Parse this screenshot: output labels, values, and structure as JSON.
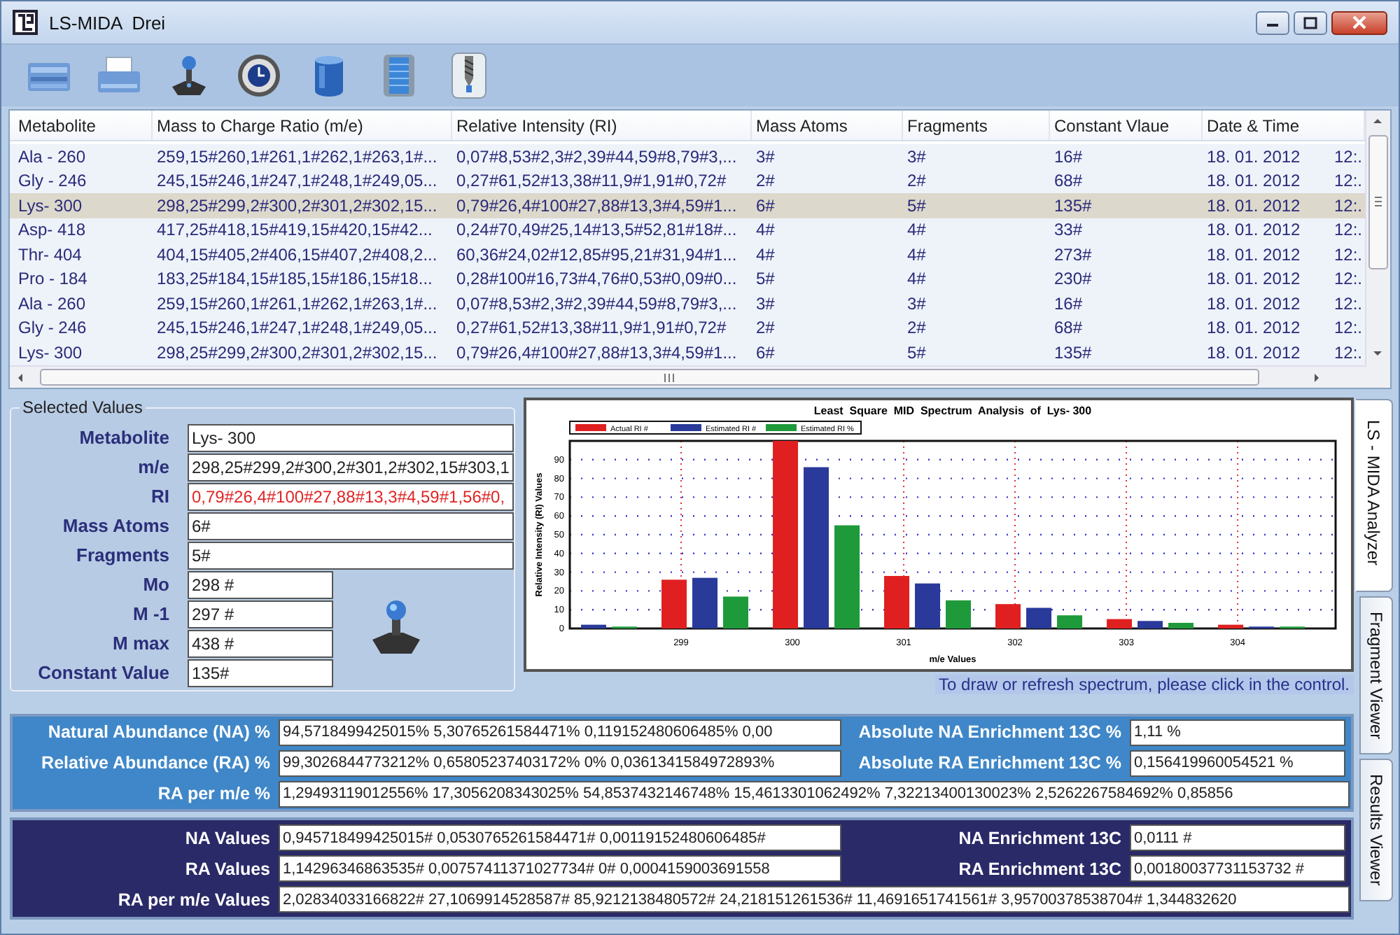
{
  "window": {
    "title": "LS-MIDA  Drei"
  },
  "table": {
    "columns": [
      "Metabolite",
      "Mass to Charge Ratio (m/e)",
      "Relative Intensity (RI)",
      "Mass Atoms",
      "Fragments",
      "Constant Vlaue",
      "Date & Time"
    ],
    "rows": [
      {
        "selected": false,
        "cells": [
          "Ala - 260",
          "259,15#260,1#261,1#262,1#263,1#...",
          "0,07#8,53#2,3#2,39#44,59#8,79#3,...",
          "3#",
          "3#",
          "16#",
          "18. 01. 2012",
          "12:."
        ]
      },
      {
        "selected": false,
        "cells": [
          "Gly - 246",
          "245,15#246,1#247,1#248,1#249,05...",
          "0,27#61,52#13,38#11,9#1,91#0,72#",
          "2#",
          "2#",
          "68#",
          "18. 01. 2012",
          "12:."
        ]
      },
      {
        "selected": true,
        "cells": [
          "Lys- 300",
          "298,25#299,2#300,2#301,2#302,15...",
          "0,79#26,4#100#27,88#13,3#4,59#1...",
          "6#",
          "5#",
          "135#",
          "18. 01. 2012",
          "12:."
        ]
      },
      {
        "selected": false,
        "cells": [
          "Asp- 418",
          "417,25#418,15#419,15#420,15#42...",
          "0,24#70,49#25,14#13,5#52,81#18#...",
          "4#",
          "4#",
          "33#",
          "18. 01. 2012",
          "12:."
        ]
      },
      {
        "selected": false,
        "cells": [
          "Thr- 404",
          "404,15#405,2#406,15#407,2#408,2...",
          "60,36#24,02#12,85#95,21#31,94#1...",
          "4#",
          "4#",
          "273#",
          "18. 01. 2012",
          "12:."
        ]
      },
      {
        "selected": false,
        "cells": [
          "Pro - 184",
          "183,25#184,15#185,15#186,15#18...",
          "0,28#100#16,73#4,76#0,53#0,09#0...",
          "5#",
          "4#",
          "230#",
          "18. 01. 2012",
          "12:."
        ]
      },
      {
        "selected": false,
        "cells": [
          "Ala - 260",
          "259,15#260,1#261,1#262,1#263,1#...",
          "0,07#8,53#2,3#2,39#44,59#8,79#3,...",
          "3#",
          "3#",
          "16#",
          "18. 01. 2012",
          "12:."
        ]
      },
      {
        "selected": false,
        "cells": [
          "Gly - 246",
          "245,15#246,1#247,1#248,1#249,05...",
          "0,27#61,52#13,38#11,9#1,91#0,72#",
          "2#",
          "2#",
          "68#",
          "18. 01. 2012",
          "12:."
        ]
      },
      {
        "selected": false,
        "cells": [
          "Lys- 300",
          "298,25#299,2#300,2#301,2#302,15...",
          "0,79#26,4#100#27,88#13,3#4,59#1...",
          "6#",
          "5#",
          "135#",
          "18. 01. 2012",
          "12:."
        ]
      }
    ]
  },
  "selected_values": {
    "title": "Selected Values",
    "fields": [
      {
        "kind": "wide",
        "label": "Metabolite",
        "value": "Lys- 300",
        "highlight": false
      },
      {
        "kind": "wide",
        "label": "m/e",
        "value": "298,25#299,2#300,2#301,2#302,15#303,1",
        "highlight": false
      },
      {
        "kind": "wide",
        "label": "RI",
        "value": "0,79#26,4#100#27,88#13,3#4,59#1,56#0,",
        "highlight": true
      },
      {
        "kind": "wide",
        "label": "Mass Atoms",
        "value": "6#",
        "highlight": false
      },
      {
        "kind": "wide",
        "label": "Fragments",
        "value": "5#",
        "highlight": false
      },
      {
        "kind": "short",
        "label": "Mo",
        "value": "298 #",
        "highlight": false
      },
      {
        "kind": "short",
        "label": "M -1",
        "value": "297 #",
        "highlight": false
      },
      {
        "kind": "short",
        "label": "M max",
        "value": "438 #",
        "highlight": false
      },
      {
        "kind": "short",
        "label": "Constant Value",
        "value": "135#",
        "highlight": false
      }
    ]
  },
  "spectrum": {
    "hint": "To draw or refresh spectrum, please click in the control.",
    "chart_data": {
      "type": "bar",
      "title": "Least  Square  MID  Spectrum  Analysis  of  Lys- 300",
      "xlabel": "m/e Values",
      "ylabel": "Relative Intensity (RI) Values",
      "x": [
        298,
        299,
        300,
        301,
        302,
        303,
        304
      ],
      "xlim": [
        298,
        304.88
      ],
      "ylim": [
        0,
        100
      ],
      "grid": true,
      "legend": true,
      "xticks": [
        299,
        300,
        301,
        302,
        303,
        304
      ],
      "yticks": [
        0,
        10,
        20,
        30,
        40,
        50,
        60,
        70,
        80,
        90
      ],
      "series": [
        {
          "name": "Actual RI #",
          "color": "#e02020",
          "values": [
            null,
            26,
            100,
            28,
            13,
            5,
            2
          ]
        },
        {
          "name": "Estimated RI #",
          "color": "#2a3a9a",
          "values": [
            2,
            27,
            86,
            24,
            11,
            4,
            1
          ]
        },
        {
          "name": "Estimated RI %",
          "color": "#1f9a3a",
          "values": [
            1,
            17,
            55,
            15,
            7,
            3,
            1
          ]
        }
      ]
    }
  },
  "result_panels": [
    {
      "kind": "percent",
      "rows": [
        {
          "label": "Natural Abundance (NA) %",
          "value": "94,5718499425015% 5,30765261584471% 0,119152480606485% 0,00",
          "side_label": "Absolute NA Enrichment 13C %",
          "side_value": "1,11 %"
        },
        {
          "label": "Relative Abundance (RA) %",
          "value": "99,3026844773212% 0,65805237403172% 0% 0,0361341584972893%",
          "side_label": "Absolute RA Enrichment 13C %",
          "side_value": "0,156419960054521 %"
        },
        {
          "label": "RA per m/e %",
          "value": "1,29493119012556% 17,3056208343025% 54,8537432146748% 15,4613301062492% 7,32213400130023% 2,5262267584692% 0,85856"
        }
      ]
    },
    {
      "kind": "values",
      "rows": [
        {
          "label": "NA Values",
          "value": "0,945718499425015# 0,0530765261584471# 0,00119152480606485#",
          "side_label": "NA Enrichment 13C",
          "side_value": "0,0111 #"
        },
        {
          "label": "RA Values",
          "value": "1,14296346863535# 0,00757411371027734# 0# 0,0004159003691558",
          "side_label": "RA Enrichment 13C",
          "side_value": "0,00180037731153732 #"
        },
        {
          "label": "RA per m/e Values",
          "value": "2,02834033166822# 27,1069914528587# 85,9212138480572# 24,218151261536# 11,4691651741561# 3,95700378538704# 1,344832620"
        }
      ]
    }
  ],
  "side_tabs": [
    {
      "label": "LS - MIDA Analyzer",
      "selected": true
    },
    {
      "label": "Fragment Viewer",
      "selected": false
    },
    {
      "label": "Results Viewer",
      "selected": false
    }
  ]
}
